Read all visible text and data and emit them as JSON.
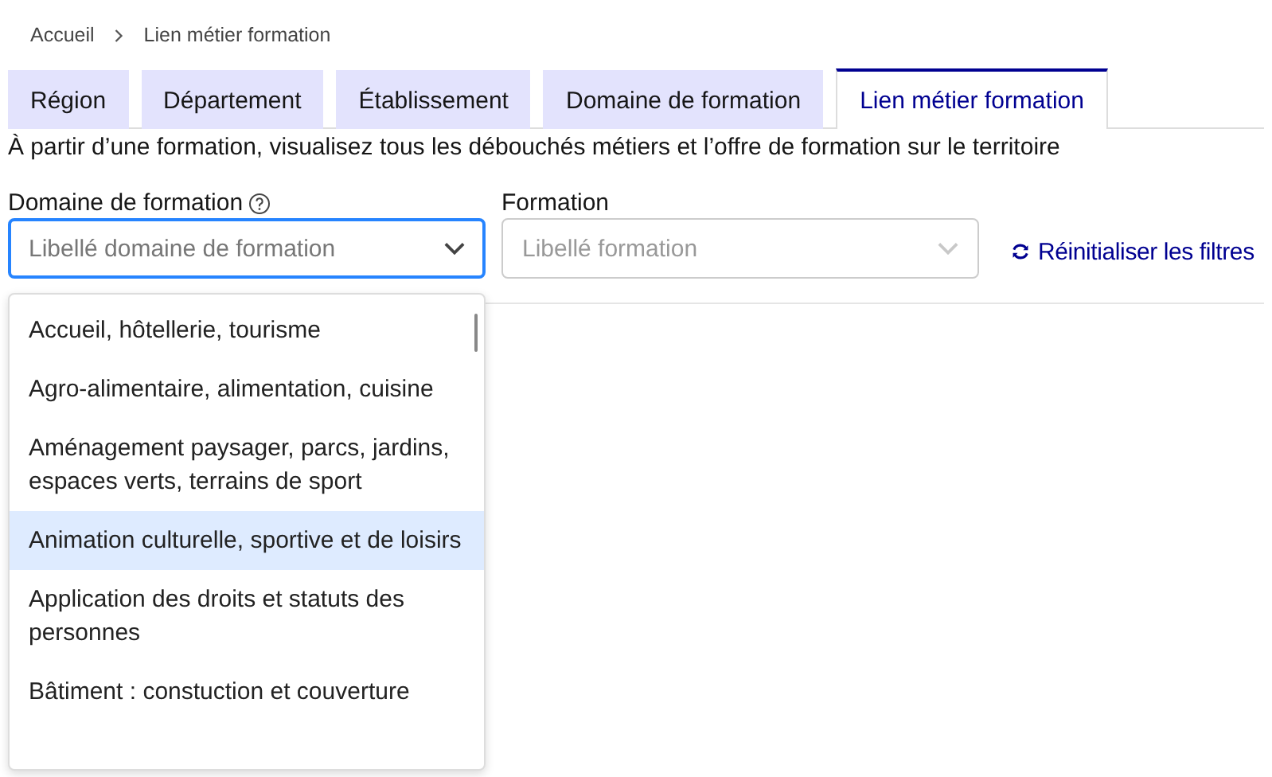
{
  "breadcrumb": [
    {
      "label": "Accueil"
    },
    {
      "label": "Lien métier formation"
    }
  ],
  "tabs": [
    {
      "label": "Région",
      "selected": false
    },
    {
      "label": "Département",
      "selected": false
    },
    {
      "label": "Établissement",
      "selected": false
    },
    {
      "label": "Domaine de formation",
      "selected": false
    },
    {
      "label": "Lien métier formation",
      "selected": true
    }
  ],
  "description": "À partir d’une formation, visualisez tous les débouchés métiers et l’offre de formation sur le territoire",
  "filters": [
    {
      "label": "Domaine de formation",
      "help": true,
      "placeholder": "Libellé domaine de formation",
      "disabled": false,
      "focused": true
    },
    {
      "label": "Formation",
      "help": false,
      "placeholder": "Libellé formation",
      "disabled": true,
      "focused": false
    }
  ],
  "reset_link": "Réinitialiser les filtres",
  "dropdown": {
    "items": [
      {
        "label": "Accueil, hôtellerie, tourisme",
        "highlighted": false
      },
      {
        "label": "Agro-alimentaire, alimentation, cuisine",
        "highlighted": false
      },
      {
        "label": "Aménagement paysager, parcs, jardins, espaces verts, terrains de sport",
        "highlighted": false
      },
      {
        "label": "Animation culturelle, sportive et de loisirs",
        "highlighted": true
      },
      {
        "label": "Application des droits et statuts des personnes",
        "highlighted": false
      },
      {
        "label": "Bâtiment : constuction et couverture",
        "highlighted": false
      }
    ]
  }
}
